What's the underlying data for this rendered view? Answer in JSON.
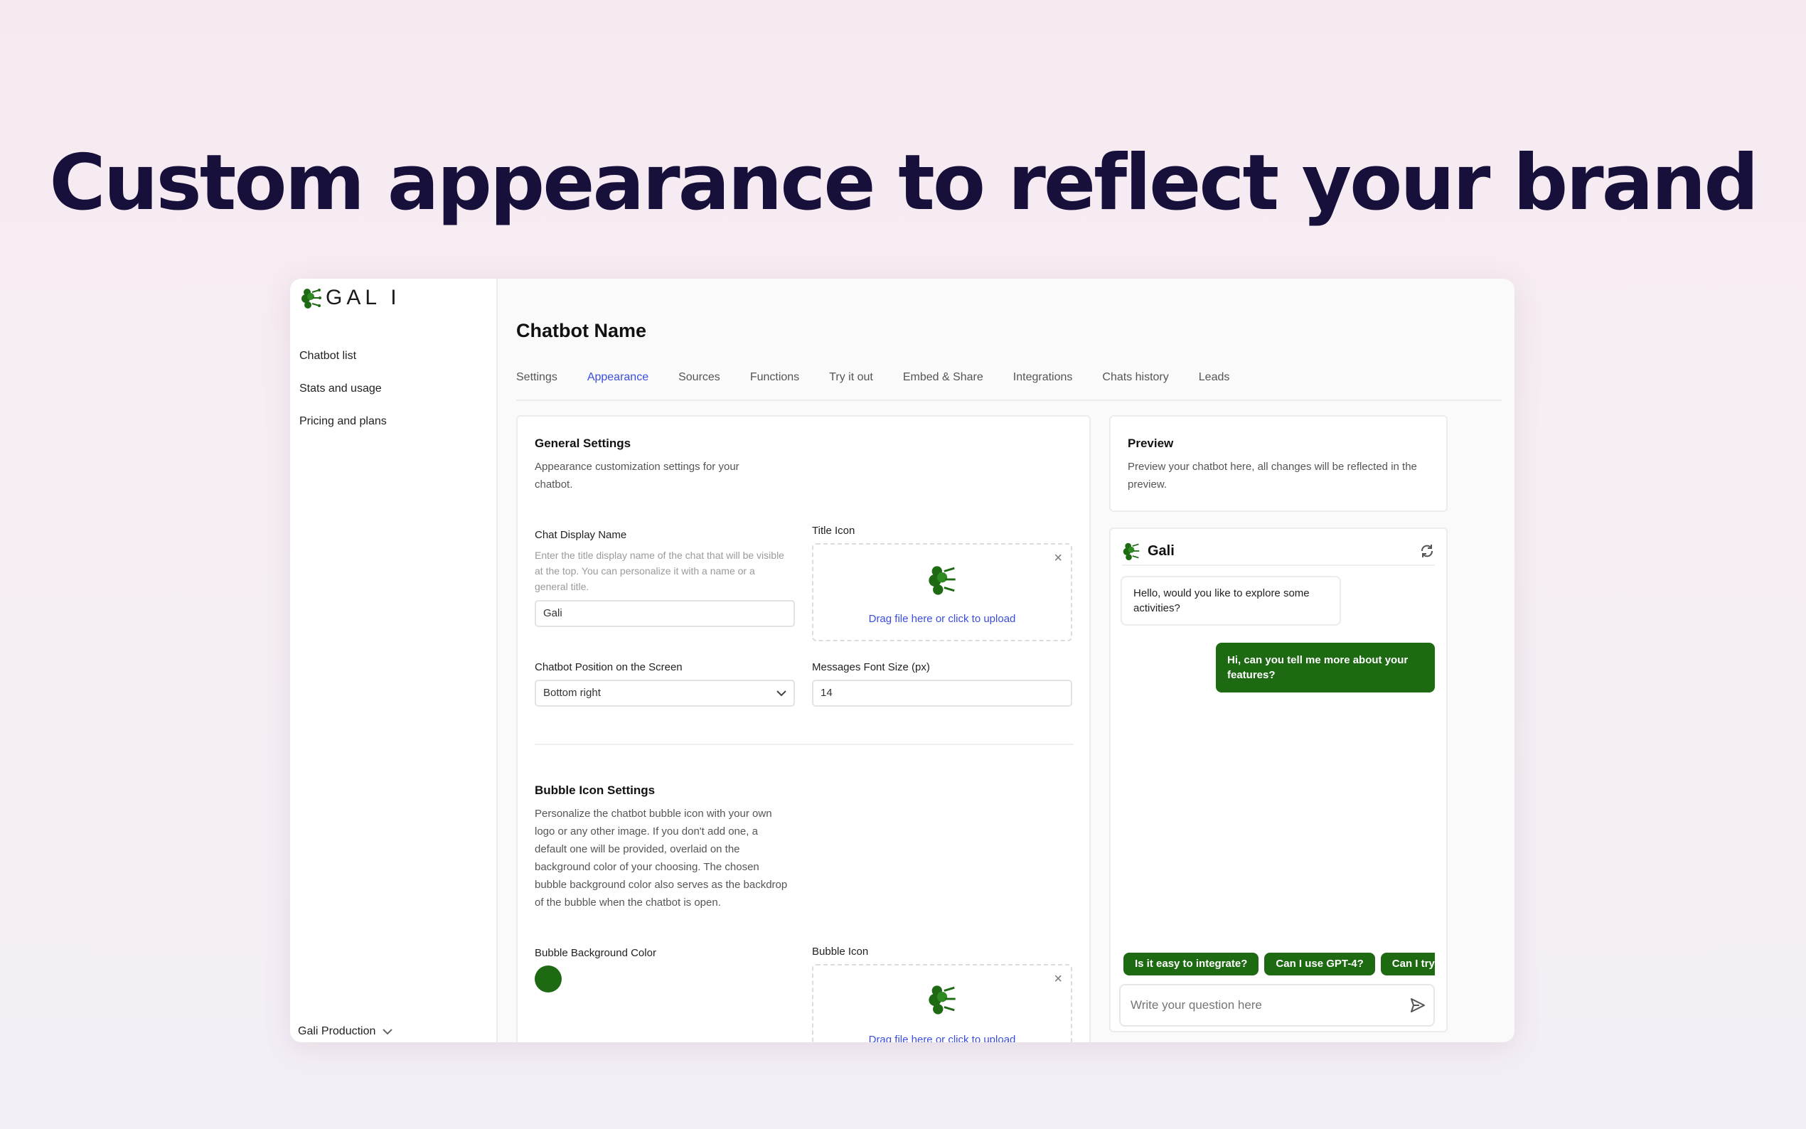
{
  "headline": "Custom appearance to reflect your brand",
  "brand": {
    "logo_text": "GAL I",
    "logo_icon": "brain-icon"
  },
  "sidebar": {
    "items": [
      {
        "label": "Chatbot list"
      },
      {
        "label": "Stats and usage"
      },
      {
        "label": "Pricing and plans"
      }
    ],
    "org_label": "Gali Production"
  },
  "page": {
    "title": "Chatbot Name"
  },
  "tabs": [
    {
      "label": "Settings"
    },
    {
      "label": "Appearance",
      "active": true
    },
    {
      "label": "Sources"
    },
    {
      "label": "Functions"
    },
    {
      "label": "Try it out"
    },
    {
      "label": "Embed & Share"
    },
    {
      "label": "Integrations"
    },
    {
      "label": "Chats history"
    },
    {
      "label": "Leads"
    }
  ],
  "general": {
    "title": "General Settings",
    "description": "Appearance customization settings for your chatbot.",
    "display_name_label": "Chat Display Name",
    "display_name_hint": "Enter the title display name of the chat that will be visible at the top. You can personalize it with a name or a general title.",
    "display_name_value": "Gali",
    "title_icon_label": "Title Icon",
    "upload_text": "Drag file here or click to upload",
    "position_label": "Chatbot Position on the Screen",
    "position_value": "Bottom right",
    "font_size_label": "Messages Font Size (px)",
    "font_size_value": "14"
  },
  "bubble": {
    "title": "Bubble Icon Settings",
    "description": "Personalize the chatbot bubble icon with your own logo or any other image. If you don't add one, a default one will be provided, overlaid on the background color of your choosing. The chosen bubble background color also serves as the backdrop of the bubble when the chatbot is open.",
    "bg_color_label": "Bubble Background Color",
    "bg_color": "#1d6a13",
    "icon_label": "Bubble Icon",
    "upload_text": "Drag file here or click to upload"
  },
  "preview": {
    "title": "Preview",
    "description": "Preview your chatbot here, all changes will be reflected in the preview.",
    "chat_name": "Gali",
    "bot_message": "Hello, would you like to explore some activities?",
    "user_message": "Hi, can you tell me more about your features?",
    "suggestions": [
      "Is it easy to integrate?",
      "Can I use GPT-4?",
      "Can I try"
    ],
    "input_placeholder": "Write your question here"
  },
  "colors": {
    "accent": "#3b4de0",
    "brand_green": "#1d6a13",
    "headline": "#17103a"
  }
}
